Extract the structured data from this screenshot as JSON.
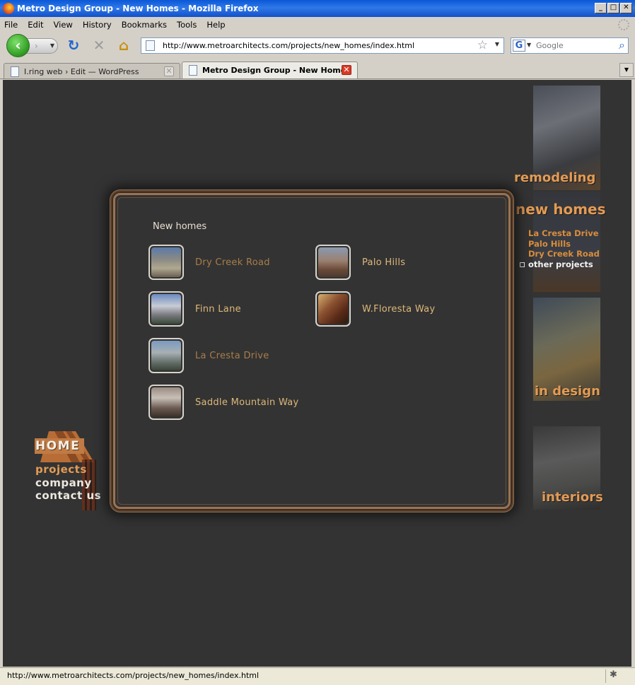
{
  "window": {
    "title": "Metro Design Group - New Homes - Mozilla Firefox",
    "controls": {
      "minimize": "_",
      "maximize": "□",
      "close": "✕"
    }
  },
  "menu": [
    "File",
    "Edit",
    "View",
    "History",
    "Bookmarks",
    "Tools",
    "Help"
  ],
  "toolbar": {
    "back_icon": "‹",
    "forward_icon": "›",
    "url": "http://www.metroarchitects.com/projects/new_homes/index.html",
    "search_engine_icon": "G",
    "search_placeholder": "Google"
  },
  "tabs": [
    {
      "label": "I.ring web › Edit — WordPress",
      "active": false
    },
    {
      "label": "Metro Design Group - New Homes",
      "active": true
    }
  ],
  "page": {
    "section_title": "New homes",
    "projects": [
      {
        "label": "Dry Creek Road",
        "visited": true
      },
      {
        "label": "Palo Hills",
        "visited": false
      },
      {
        "label": "Finn Lane",
        "visited": false
      },
      {
        "label": "W.Floresta Way",
        "visited": false
      },
      {
        "label": "La Cresta Drive",
        "visited": true
      },
      {
        "label": "Saddle Mountain Way",
        "visited": false
      }
    ],
    "right_nav": {
      "remodeling": "remodeling",
      "new_homes": "new homes",
      "sub_links": [
        "La Cresta Drive",
        "Palo Hills",
        "Dry Creek Road"
      ],
      "other_projects": "other projects",
      "in_design": "in design",
      "interiors": "interiors"
    },
    "left_nav": {
      "home": "HOME",
      "projects": "projects",
      "company": "company",
      "contact": "contact us"
    }
  },
  "status": {
    "text": "http://www.metroarchitects.com/projects/new_homes/index.html"
  },
  "colors": {
    "page_bg": "#333333",
    "accent_orange": "#e39b54",
    "link_unvisited": "#ddb87a",
    "link_visited": "#a97d4c",
    "panel_border": "#9a7352"
  }
}
